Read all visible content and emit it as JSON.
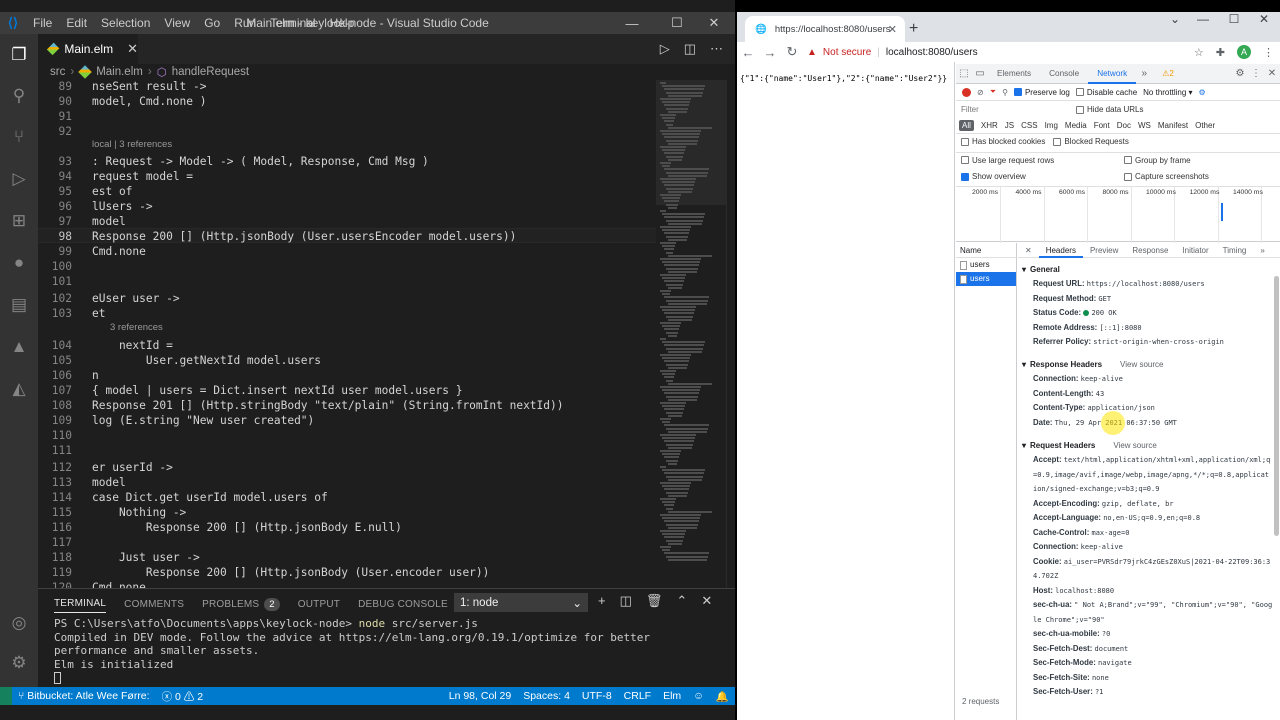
{
  "vscode": {
    "menu": [
      "File",
      "Edit",
      "Selection",
      "View",
      "Go",
      "Run",
      "Terminal",
      "Help"
    ],
    "window_title": "Main.elm - keylock-node - Visual Studio Code",
    "tab": {
      "label": "Main.elm"
    },
    "breadcrumb": {
      "folder": "src",
      "file": "Main.elm",
      "symbol": "handleRequest"
    },
    "lines": [
      {
        "n": "89",
        "text": "nseSent result ->"
      },
      {
        "n": "90",
        "text": "model, Cmd.none )"
      },
      {
        "n": "91",
        "text": ""
      },
      {
        "n": "92",
        "text": ""
      },
      {
        "n": "93",
        "text": ": Request -> Model -> ( Model, Response, Cmd Msg )"
      },
      {
        "n": "94",
        "text": "request model ="
      },
      {
        "n": "95",
        "text": "est of"
      },
      {
        "n": "96",
        "text": "lUsers ->"
      },
      {
        "n": "97",
        "text": "model"
      },
      {
        "n": "98",
        "text": "Response 200 [] (Http.jsonBody (User.usersEncoder model.users))"
      },
      {
        "n": "99",
        "text": "Cmd.none"
      },
      {
        "n": "100",
        "text": ""
      },
      {
        "n": "101",
        "text": ""
      },
      {
        "n": "102",
        "text": "eUser user ->"
      },
      {
        "n": "103",
        "text": "et"
      },
      {
        "n": "104",
        "text": "    nextId ="
      },
      {
        "n": "105",
        "text": "        User.getNextId model.users"
      },
      {
        "n": "106",
        "text": "n"
      },
      {
        "n": "107",
        "text": "{ model | users = Dict.insert nextId user model.users }"
      },
      {
        "n": "108",
        "text": "Response 201 [] (Http.stringBody \"text/plain\" (String.fromInt nextId))"
      },
      {
        "n": "109",
        "text": "log (E.string \"New user created\")"
      },
      {
        "n": "110",
        "text": ""
      },
      {
        "n": "111",
        "text": ""
      },
      {
        "n": "112",
        "text": "er userId ->"
      },
      {
        "n": "113",
        "text": "model"
      },
      {
        "n": "114",
        "text": "case Dict.get userId model.users of"
      },
      {
        "n": "115",
        "text": "    Nothing ->"
      },
      {
        "n": "116",
        "text": "        Response 200 [] (Http.jsonBody E.null)"
      },
      {
        "n": "117",
        "text": ""
      },
      {
        "n": "118",
        "text": "    Just user ->"
      },
      {
        "n": "119",
        "text": "        Response 200 [] (Http.jsonBody (User.encoder user))"
      },
      {
        "n": "120",
        "text": "Cmd.none"
      }
    ],
    "codelens": {
      "handle": "local | 3 references",
      "next_id": "3 references"
    },
    "panel": {
      "tabs": [
        "TERMINAL",
        "COMMENTS",
        "PROBLEMS",
        "OUTPUT",
        "DEBUG CONSOLE"
      ],
      "problems_count": "2",
      "terminal_select": "1: node",
      "terminal_prompt": "PS C:\\Users\\atfo\\Documents\\apps\\keylock-node>",
      "terminal_cmd": "node",
      "terminal_arg": "src/server.js",
      "terminal_out1": "Compiled in DEV mode. Follow the advice at https://elm-lang.org/0.19.1/optimize for better performance and smaller assets.",
      "terminal_out2": "Elm is initialized"
    },
    "status": {
      "branch": "Bitbucket: Atle Wee Førre:",
      "errors": "0",
      "warnings": "2",
      "position": "Ln 98, Col 29",
      "spaces": "Spaces: 4",
      "encoding": "UTF-8",
      "eol": "CRLF",
      "language": "Elm"
    }
  },
  "browser": {
    "tab_title": "https://localhost:8080/users",
    "not_secure": "Not secure",
    "url": "localhost:8080/users",
    "avatar_letter": "A",
    "page_content": "{\"1\":{\"name\":\"User1\"},\"2\":{\"name\":\"User2\"}}",
    "devtools": {
      "tabs": [
        "Elements",
        "Console",
        "Network"
      ],
      "warnings": "2",
      "preserve_log": "Preserve log",
      "disable_cache": "Disable cache",
      "throttling": "No throttling",
      "filter_placeholder": "Filter",
      "hide_data_urls": "Hide data URLs",
      "types": [
        "All",
        "XHR",
        "JS",
        "CSS",
        "Img",
        "Media",
        "Font",
        "Doc",
        "WS",
        "Manifest",
        "Other"
      ],
      "has_blocked_cookies": "Has blocked cookies",
      "blocked_requests": "Blocked Requests",
      "use_large_rows": "Use large request rows",
      "group_by_frame": "Group by frame",
      "show_overview": "Show overview",
      "capture_screenshots": "Capture screenshots",
      "timeline_ticks": [
        "2000 ms",
        "4000 ms",
        "6000 ms",
        "8000 ms",
        "10000 ms",
        "12000 ms",
        "14000 ms"
      ],
      "list_header": "Name",
      "requests": [
        "users",
        "users"
      ],
      "requests_count": "2 requests",
      "detail_tabs": [
        "Headers",
        "Preview",
        "Response",
        "Initiator",
        "Timing"
      ],
      "general_title": "General",
      "general": [
        {
          "k": "Request URL:",
          "v": "https://localhost:8080/users"
        },
        {
          "k": "Request Method:",
          "v": "GET"
        },
        {
          "k": "Status Code:",
          "v": "200 OK"
        },
        {
          "k": "Remote Address:",
          "v": "[::1]:8080"
        },
        {
          "k": "Referrer Policy:",
          "v": "strict-origin-when-cross-origin"
        }
      ],
      "response_headers_title": "Response Headers",
      "view_source": "View source",
      "response_headers": [
        {
          "k": "Connection:",
          "v": "keep-alive"
        },
        {
          "k": "Content-Length:",
          "v": "43"
        },
        {
          "k": "Content-Type:",
          "v": "application/json"
        },
        {
          "k": "Date:",
          "v": "Thu, 29 Apr 2021 06:37:50 GMT"
        }
      ],
      "request_headers_title": "Request Headers",
      "request_headers": [
        {
          "k": "Accept:",
          "v": "text/html,application/xhtml+xml,application/xml;q=0.9,image/avif,image/webp,image/apng,*/*;q=0.8,application/signed-exchange;v=b3;q=0.9"
        },
        {
          "k": "Accept-Encoding:",
          "v": "gzip, deflate, br"
        },
        {
          "k": "Accept-Language:",
          "v": "no,en-US;q=0.9,en;q=0.8"
        },
        {
          "k": "Cache-Control:",
          "v": "max-age=0"
        },
        {
          "k": "Connection:",
          "v": "keep-alive"
        },
        {
          "k": "Cookie:",
          "v": "ai_user=PVRSdr79jrkC4zGEsZ0XuS|2021-04-22T09:36:34.702Z"
        },
        {
          "k": "Host:",
          "v": "localhost:8080"
        },
        {
          "k": "sec-ch-ua:",
          "v": "\" Not A;Brand\";v=\"99\", \"Chromium\";v=\"90\", \"Google Chrome\";v=\"90\""
        },
        {
          "k": "sec-ch-ua-mobile:",
          "v": "?0"
        },
        {
          "k": "Sec-Fetch-Dest:",
          "v": "document"
        },
        {
          "k": "Sec-Fetch-Mode:",
          "v": "navigate"
        },
        {
          "k": "Sec-Fetch-Site:",
          "v": "none"
        },
        {
          "k": "Sec-Fetch-User:",
          "v": "?1"
        }
      ]
    }
  }
}
